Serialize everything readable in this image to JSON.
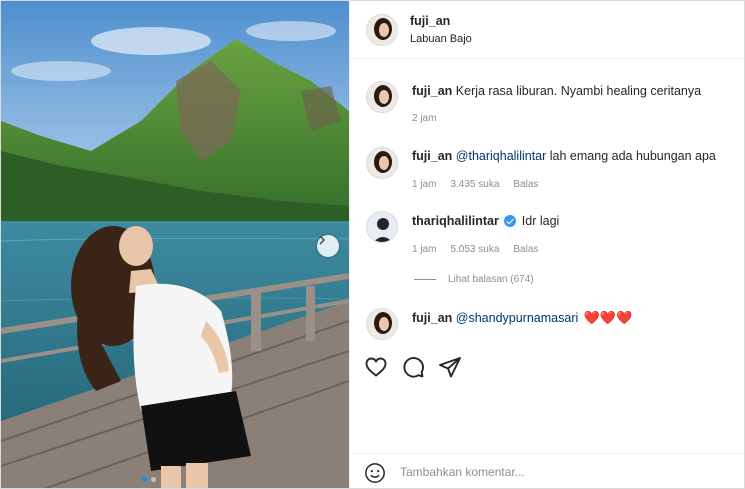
{
  "post": {
    "author": "fuji_an",
    "location": "Labuan Bajo",
    "carousel": {
      "slide_count": 2,
      "active_index": 0,
      "next_icon": "chevron-right-icon"
    }
  },
  "comments": [
    {
      "username": "fuji_an",
      "text": "Kerja rasa liburan. Nyambi healing ceritanya",
      "time": "2 jam"
    },
    {
      "username": "fuji_an",
      "mention": "@thariqhalilintar",
      "text": " lah emang ada hubungan apa",
      "time": "1 jam",
      "likes": "3.435 suka",
      "reply": "Balas"
    },
    {
      "username": "thariqhalilintar",
      "verified": true,
      "text": "Idr lagi",
      "time": "1 jam",
      "likes": "5.053 suka",
      "reply": "Balas"
    },
    {
      "username": "fuji_an",
      "mention": "@shandypurnamasari",
      "text": "❤️❤️❤️"
    }
  ],
  "view_replies": "Lihat balasan (674)",
  "actions": [
    "heart-icon",
    "comment-icon",
    "share-icon"
  ],
  "add_comment": {
    "placeholder": "Tambahkan komentar...",
    "icon": "smiley-icon"
  },
  "colors": {
    "mention": "#00376b",
    "meta": "#8e8e8e",
    "verified": "#3897f0",
    "heart": "#e0245e",
    "active_dot": "#0095f6"
  }
}
